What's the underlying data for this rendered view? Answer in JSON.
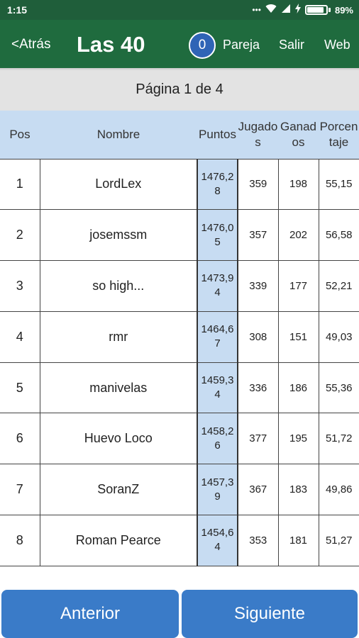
{
  "status_bar": {
    "time": "1:15",
    "icons": [
      "dots-icon",
      "wifi-icon",
      "signal-icon",
      "charging-icon",
      "battery-icon"
    ],
    "battery_percent": "89%",
    "battery_level": 0.89
  },
  "appbar": {
    "back_label": "<Atrás",
    "title": "Las 40",
    "badge_count": "0",
    "nav": [
      "Pareja",
      "Salir",
      "Web"
    ],
    "color": "#1f6b3e"
  },
  "page_indicator": "Página 1 de 4",
  "table": {
    "headers": [
      "Pos",
      "Nombre",
      "Puntos",
      "Jugados",
      "Ganados",
      "Porcentaje"
    ],
    "rows": [
      [
        "1",
        "LordLex",
        "1476,28",
        "359",
        "198",
        "55,15"
      ],
      [
        "2",
        "josemssm",
        "1476,05",
        "357",
        "202",
        "56,58"
      ],
      [
        "3",
        "so high...",
        "1473,94",
        "339",
        "177",
        "52,21"
      ],
      [
        "4",
        "rmr",
        "1464,67",
        "308",
        "151",
        "49,03"
      ],
      [
        "5",
        "manivelas",
        "1459,34",
        "336",
        "186",
        "55,36"
      ],
      [
        "6",
        "Huevo Loco",
        "1458,26",
        "377",
        "195",
        "51,72"
      ],
      [
        "7",
        "SoranZ",
        "1457,39",
        "367",
        "183",
        "49,86"
      ],
      [
        "8",
        "Roman Pearce",
        "1454,64",
        "353",
        "181",
        "51,27"
      ]
    ],
    "header_color": "#c7dcf2"
  },
  "footer": {
    "prev_label": "Anterior",
    "next_label": "Siguiente",
    "button_color": "#3a7bc8"
  }
}
